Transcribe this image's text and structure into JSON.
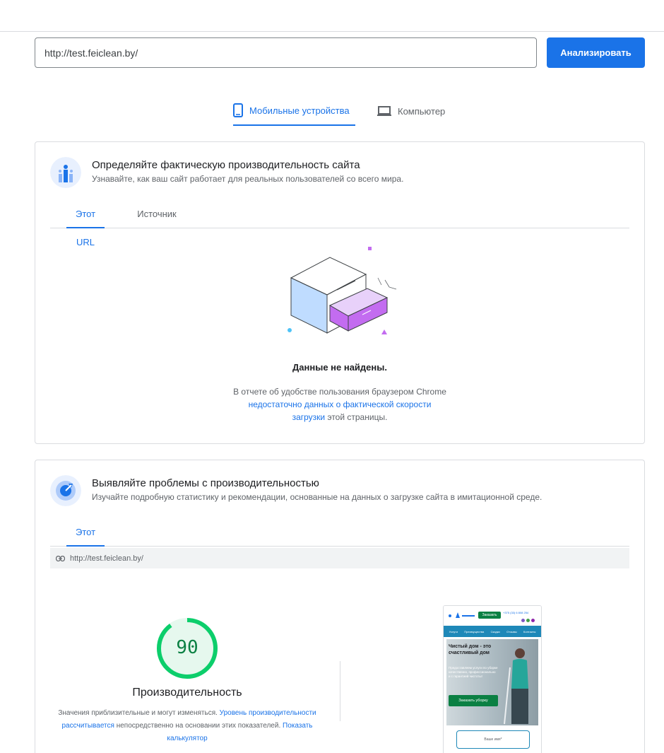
{
  "search": {
    "value": "http://test.feiclean.by/",
    "button_label": "Анализировать"
  },
  "device_tabs": {
    "mobile": "Мобильные устройства",
    "desktop": "Компьютер"
  },
  "field_data": {
    "title": "Определяйте фактическую производительность сайта",
    "subtitle": "Узнавайте, как ваш сайт работает для реальных пользователей со всего мира.",
    "tabs": [
      "Этот URL",
      "Источник"
    ],
    "empty_title": "Данные не найдены.",
    "empty_text_1": "В отчете об удобстве пользования браузером Chrome ",
    "empty_link": "недостаточно данных о фактической скорости загрузки",
    "empty_text_2": " этой страницы."
  },
  "lab_data": {
    "title": "Выявляйте проблемы с производительностью",
    "subtitle": "Изучайте подробную статистику и рекомендации, основанные на данных о загрузке сайта в имитационной среде.",
    "tab": "Этот URL",
    "url": "http://test.feiclean.by/",
    "score": "90",
    "score_fraction": 0.9,
    "score_color": "#0cce6b",
    "category": "Производительность",
    "desc_1": "Значения приблизительные и могут изменяться. ",
    "desc_link_1": "Уровень производительности рассчитывается",
    "desc_2": " непосредственно на основании этих показателей. ",
    "desc_link_2": "Показать калькулятор"
  },
  "screenshot": {
    "order_label": "Заказать",
    "phone_text": "+375 (33) 6 808 254",
    "nav": [
      "Услуги",
      "Преимущества",
      "Скидки",
      "Отзывы",
      "Контакты"
    ],
    "hero_title": "Чистый дом - это счастливый дом",
    "hero_text": "Предоставляем услуги по уборке качественно, профессионально и с гарантией чистоты!",
    "cta": "Заказать уборку",
    "field_placeholder": "Ваше имя*"
  },
  "colors": {
    "accent": "#1a73e8",
    "score_good": "#0cce6b",
    "empty_purple": "#c36cf0",
    "empty_blue": "#bfdcff"
  }
}
